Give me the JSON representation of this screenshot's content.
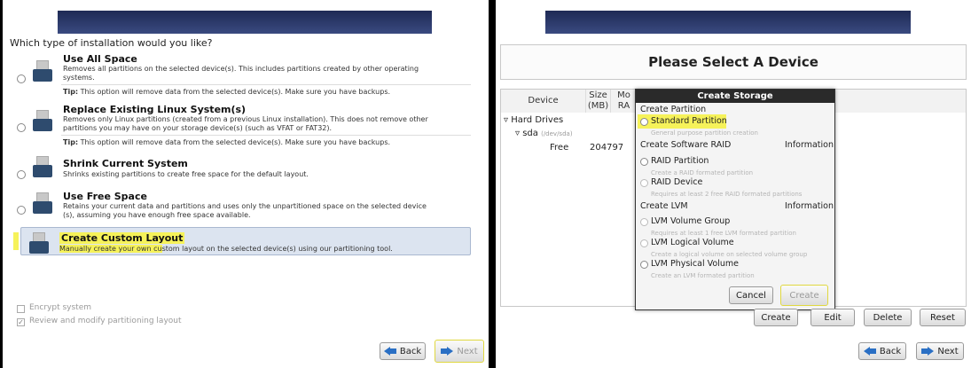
{
  "left": {
    "question": "Which type of installation would you like?",
    "options": [
      {
        "title": "Use All Space",
        "desc": "Removes all partitions on the selected device(s). This includes partitions created by other operating systems."
      },
      {
        "title": "Replace Existing Linux System(s)",
        "desc": "Removes only Linux partitions (created from a previous Linux installation). This does not remove other partitions you may have on your storage device(s) (such as VFAT or FAT32)."
      },
      {
        "title": "Shrink Current System",
        "desc": "Shrinks existing partitions to create free space for the default layout."
      },
      {
        "title": "Use Free Space",
        "desc": "Retains your current data and partitions and uses only the unpartitioned space on the selected device (s), assuming you have enough free space available."
      }
    ],
    "tip_label": "Tip:",
    "tip_text": "This option will remove data from the selected device(s). Make sure you have backups.",
    "custom": {
      "title": "Create Custom Layout",
      "desc_hl": "Manually create your own cu",
      "desc_rest": "stom layout on the selected device(s) using our partitioning tool."
    },
    "encrypt_label": "Encrypt system",
    "review_label": "Review and modify partitioning layout",
    "back_label": "Back",
    "next_label": "Next"
  },
  "right": {
    "header": "Please Select A Device",
    "columns": {
      "device": "Device",
      "size": "Size\n(MB)",
      "mount": "Mo\nRA"
    },
    "tree": {
      "hard_drives": "Hard Drives",
      "sda": "sda",
      "sda_path": "(/dev/sda)",
      "free": "Free",
      "free_size": "204797"
    },
    "dialog": {
      "title": "Create Storage",
      "create_partition": "Create Partition",
      "standard_partition": "Standard Partition",
      "standard_sub": "General purpose partition creation",
      "software_raid": "Create Software RAID",
      "information": "Information",
      "raid_partition": "RAID Partition",
      "raid_partition_sub": "Create a RAID formated partition",
      "raid_device": "RAID Device",
      "raid_device_sub": "Requires at least 2 free RAID formated partitions",
      "create_lvm": "Create LVM",
      "lvm_group": "LVM Volume Group",
      "lvm_group_sub": "Requires at least 1 free LVM formated partition",
      "lvm_logical": "LVM Logical Volume",
      "lvm_logical_sub": "Create a logical volume on selected volume group",
      "lvm_physical": "LVM Physical Volume",
      "lvm_physical_sub": "Create an LVM formated partition",
      "cancel": "Cancel",
      "create": "Create"
    },
    "buttons": {
      "create": "Create",
      "edit": "Edit",
      "delete": "Delete",
      "reset": "Reset",
      "back": "Back",
      "next": "Next"
    }
  },
  "colors": {
    "highlight": "#f6f25a",
    "accent": "#2a6fc4"
  }
}
